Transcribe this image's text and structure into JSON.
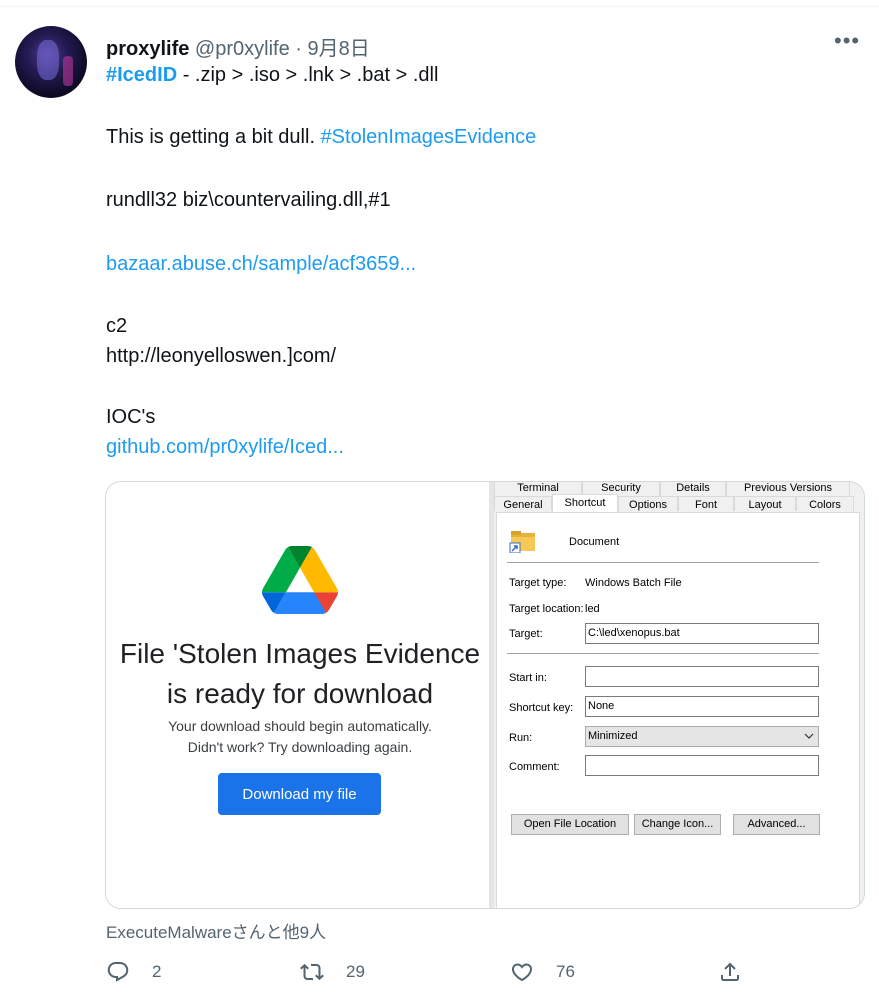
{
  "tweet": {
    "name": "proxylife",
    "handle": "@pr0xylife",
    "date_sep": " · ",
    "date": "9月8日",
    "more": "•••",
    "line1_hashtag": "#IcedID",
    "line1_rest": " - .zip > .iso > .lnk > .bat > .dll",
    "line2_text": "This is getting a bit dull. ",
    "line2_hashtag": "#StolenImagesEvidence",
    "line3": "rundll32  biz\\countervailing.dll,#1",
    "line4_link": "bazaar.abuse.ch/sample/acf3659...",
    "line5": "c2",
    "line6": "http://leonyelloswen.]com/",
    "line7": "IOC's",
    "line8_link": "github.com/pr0xylife/Iced..."
  },
  "media": {
    "left": {
      "title_line1": "File 'Stolen Images Evidence",
      "title_line2": "is ready for download",
      "sub1": "Your download should begin automatically.",
      "sub2": "Didn't work? Try downloading again.",
      "button": "Download my file"
    },
    "right": {
      "tabs_row1": [
        "Terminal",
        "Security",
        "Details",
        "Previous Versions"
      ],
      "tabs_row2": [
        "General",
        "Shortcut",
        "Options",
        "Font",
        "Layout",
        "Colors"
      ],
      "doc_name": "Document",
      "target_type_label": "Target type:",
      "target_type_value": "Windows Batch File",
      "target_location_label": "Target location:",
      "target_location_value": "led",
      "target_label": "Target:",
      "target_value": "C:\\led\\xenopus.bat",
      "start_in_label": "Start in:",
      "start_in_value": "",
      "shortcut_key_label": "Shortcut key:",
      "shortcut_key_value": "None",
      "run_label": "Run:",
      "run_value": "Minimized",
      "comment_label": "Comment:",
      "comment_value": "",
      "buttons": [
        "Open File Location",
        "Change Icon...",
        "Advanced..."
      ]
    }
  },
  "likers": "ExecuteMalwareさんと他9人",
  "actions": {
    "reply_count": "2",
    "retweet_count": "29",
    "like_count": "76"
  },
  "colors": {
    "link": "#1d9bf0",
    "text": "#0f1419",
    "muted": "#536471",
    "drive_button": "#1a73e8"
  }
}
